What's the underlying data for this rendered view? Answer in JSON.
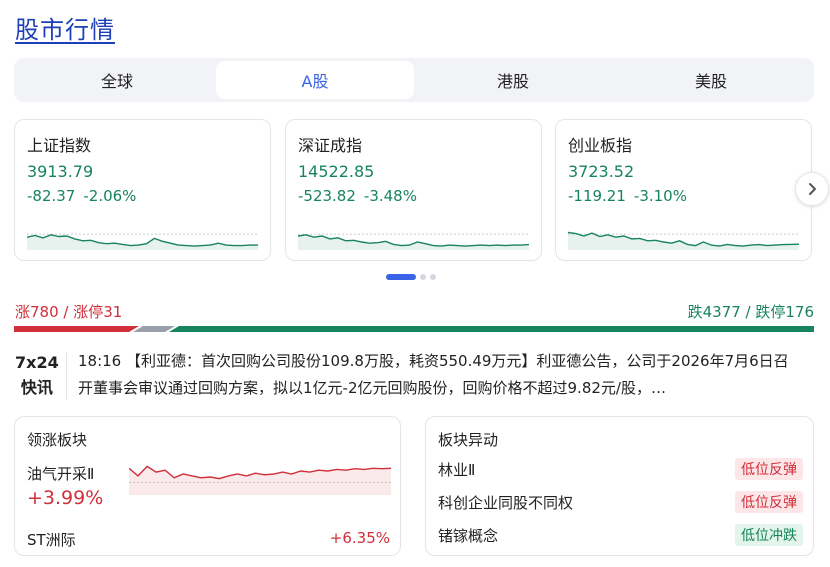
{
  "page_title": "股市行情",
  "tabs": [
    {
      "label": "全球",
      "active": false
    },
    {
      "label": "A股",
      "active": true
    },
    {
      "label": "港股",
      "active": false
    },
    {
      "label": "美股",
      "active": false
    }
  ],
  "indices": [
    {
      "name": "上证指数",
      "value": "3913.79",
      "change": "-82.37",
      "pct": "-2.06%",
      "spark": [
        0.55,
        0.48,
        0.58,
        0.45,
        0.52,
        0.5,
        0.62,
        0.7,
        0.68,
        0.78,
        0.82,
        0.8,
        0.85,
        0.9,
        0.88,
        0.82,
        0.6,
        0.72,
        0.8,
        0.88,
        0.9,
        0.92,
        0.9,
        0.88,
        0.8,
        0.88,
        0.9,
        0.9,
        0.88,
        0.88
      ]
    },
    {
      "name": "深证成指",
      "value": "14522.85",
      "change": "-523.82",
      "pct": "-3.48%",
      "spark": [
        0.5,
        0.45,
        0.55,
        0.5,
        0.62,
        0.58,
        0.7,
        0.68,
        0.75,
        0.8,
        0.78,
        0.72,
        0.85,
        0.9,
        0.88,
        0.75,
        0.82,
        0.9,
        0.92,
        0.88,
        0.9,
        0.92,
        0.9,
        0.88,
        0.9,
        0.88,
        0.9,
        0.88,
        0.88,
        0.86
      ]
    },
    {
      "name": "创业板指",
      "value": "3723.52",
      "change": "-119.21",
      "pct": "-3.10%",
      "spark": [
        0.35,
        0.4,
        0.5,
        0.38,
        0.52,
        0.45,
        0.55,
        0.5,
        0.62,
        0.6,
        0.7,
        0.68,
        0.75,
        0.8,
        0.7,
        0.85,
        0.9,
        0.75,
        0.88,
        0.92,
        0.85,
        0.9,
        0.92,
        0.88,
        0.86,
        0.9,
        0.88,
        0.86,
        0.85,
        0.84
      ]
    }
  ],
  "carousel": {
    "pages": 3,
    "active": 0
  },
  "breadth": {
    "up_text": "涨780 / 涨停31",
    "down_text": "跌4377 / 跌停176",
    "up_fraction": 0.15,
    "flat_fraction": 0.04
  },
  "flash": {
    "date": "7x24",
    "label": "快讯",
    "text": "18:16 【利亚德：首次回购公司股份109.8万股，耗资550.49万元】利亚德公告，公司于2026年7月6日召开董事会审议通过回购方案，拟以1亿元-2亿元回购股份，回购价格不超过9.82元/股，…"
  },
  "leading_sector": {
    "title": "领涨板块",
    "name": "油气开采Ⅱ",
    "pct": "+3.99%",
    "spark": [
      0.35,
      0.55,
      0.3,
      0.45,
      0.4,
      0.6,
      0.5,
      0.55,
      0.6,
      0.58,
      0.62,
      0.55,
      0.5,
      0.55,
      0.48,
      0.52,
      0.5,
      0.45,
      0.5,
      0.42,
      0.45,
      0.4,
      0.42,
      0.38,
      0.4,
      0.36,
      0.38,
      0.35,
      0.36,
      0.35
    ],
    "sub_name": "ST洲际",
    "sub_pct": "+6.35%"
  },
  "sector_alerts": {
    "title": "板块异动",
    "items": [
      {
        "name": "林业Ⅱ",
        "tag": "低位反弹",
        "direction": "up"
      },
      {
        "name": "科创企业同股不同权",
        "tag": "低位反弹",
        "direction": "up"
      },
      {
        "name": "锗镓概念",
        "tag": "低位冲跌",
        "direction": "down"
      }
    ]
  },
  "colors": {
    "up": "#d12f3a",
    "down": "#17845d",
    "accent": "#3a64e8",
    "title": "#1d3fb8"
  },
  "icons": {
    "next": "chevron-right-icon"
  }
}
